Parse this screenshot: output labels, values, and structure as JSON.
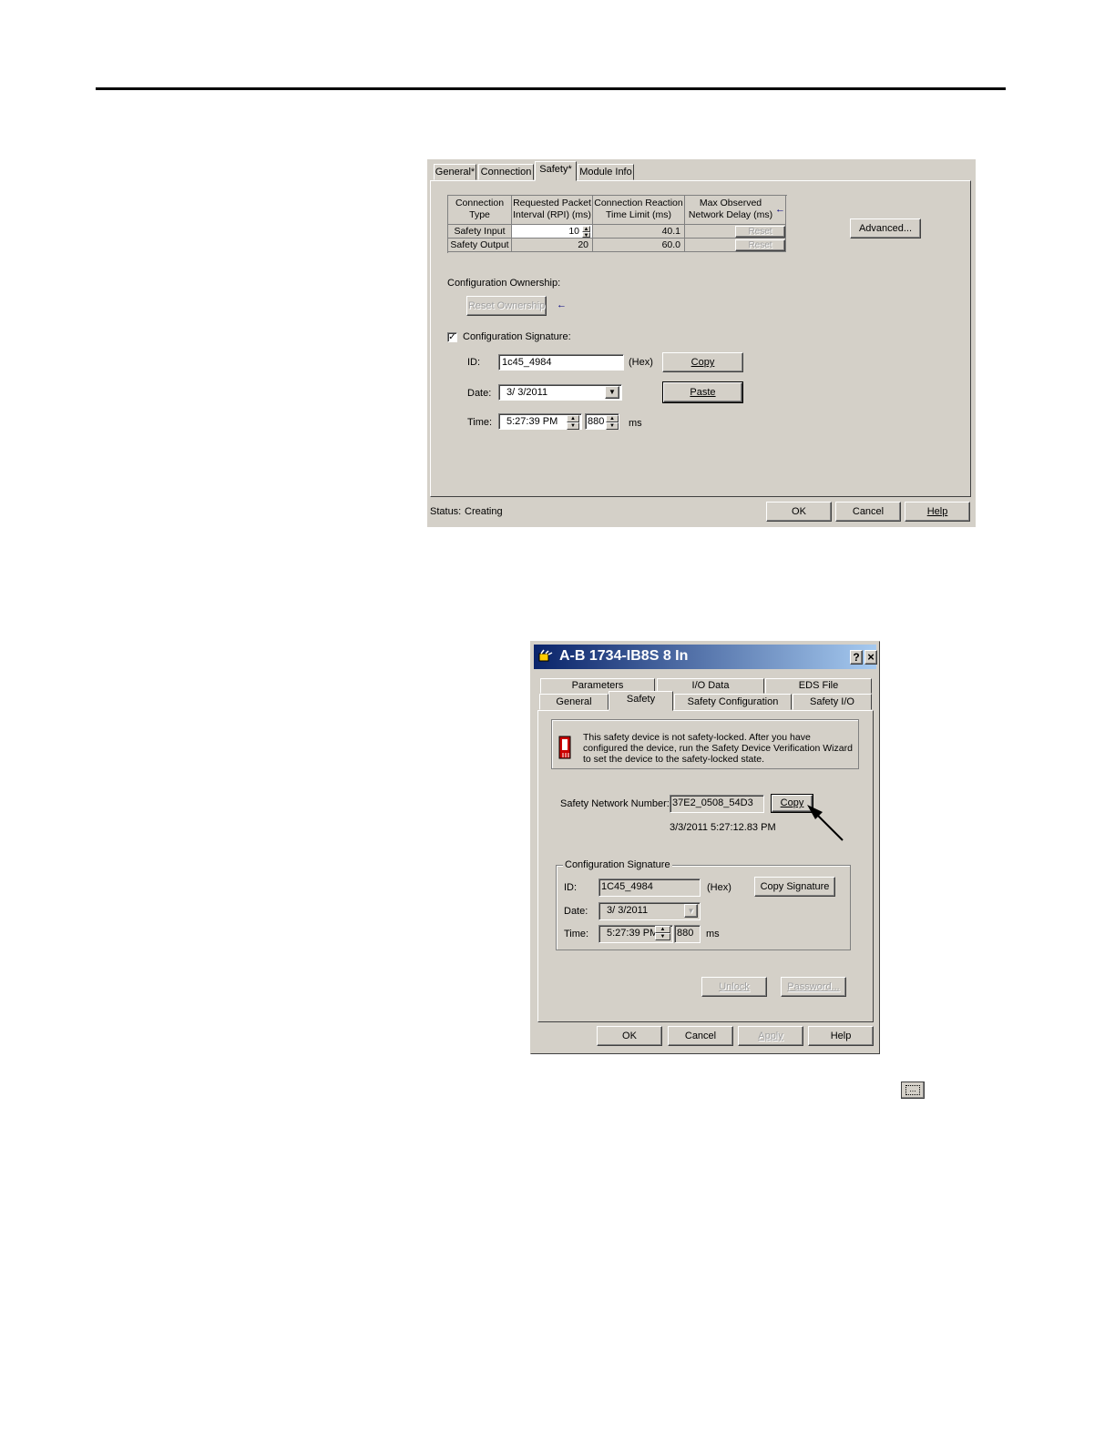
{
  "dialog1": {
    "tabs": [
      "General*",
      "Connection",
      "Safety*",
      "Module Info"
    ],
    "table": {
      "headers": [
        "Connection Type",
        "Requested Packet Interval (RPI) (ms)",
        "Connection Reaction Time Limit (ms)",
        "Max Observed Network Delay (ms)"
      ],
      "rows": [
        {
          "type": "Safety Input",
          "rpi": "10",
          "limit": "40.1",
          "delay": "",
          "reset": "Reset"
        },
        {
          "type": "Safety Output",
          "rpi": "20",
          "limit": "60.0",
          "delay": "",
          "reset": "Reset"
        }
      ]
    },
    "advanced_button": "Advanced...",
    "ownership_label": "Configuration Ownership:",
    "reset_ownership_button": "Reset Ownership",
    "signature_checkbox_label": "Configuration Signature:",
    "signature_checked": true,
    "id_label": "ID:",
    "id_value": "1c45_4984",
    "hex_label": "(Hex)",
    "copy_button": "Copy",
    "date_label": "Date:",
    "date_value": "3/ 3/2011",
    "paste_button": "Paste",
    "time_label": "Time:",
    "time_value": "5:27:39 PM",
    "ms_value": "880",
    "ms_label": "ms",
    "status_label": "Status:",
    "status_value": "Creating",
    "ok_button": "OK",
    "cancel_button": "Cancel",
    "help_button": "Help"
  },
  "dialog2": {
    "title": "A-B 1734-IB8S 8 In",
    "help_glyph": "?",
    "close_glyph": "×",
    "tabs_row1": [
      "Parameters",
      "I/O Data",
      "EDS File"
    ],
    "tabs_row2": [
      "General",
      "Safety",
      "Safety Configuration",
      "Safety I/O"
    ],
    "warning_text": "This safety device is not safety-locked. After you have configured the device, run the Safety Device Verification Wizard to set the device to the safety-locked state.",
    "snn_label": "Safety Network Number:",
    "snn_value": "37E2_0508_54D3",
    "snn_copy_button": "Copy",
    "snn_timestamp": "3/3/2011 5:27:12.83 PM",
    "group_title": "Configuration Signature",
    "id_label": "ID:",
    "id_value": "1C45_4984",
    "hex_label": "(Hex)",
    "copy_signature_button": "Copy Signature",
    "date_label": "Date:",
    "date_value": "3/ 3/2011",
    "time_label": "Time:",
    "time_value": "5:27:39 PM",
    "ms_value": "880",
    "ms_label": "ms",
    "unlock_button": "Unlock",
    "password_button": "Password...",
    "ok_button": "OK",
    "cancel_button": "Cancel",
    "apply_button": "Apply",
    "help_button": "Help"
  },
  "colors": {
    "dialog": "#d4d0c8",
    "titlebar_start": "#0a246a",
    "titlebar_end": "#a6caf0"
  }
}
